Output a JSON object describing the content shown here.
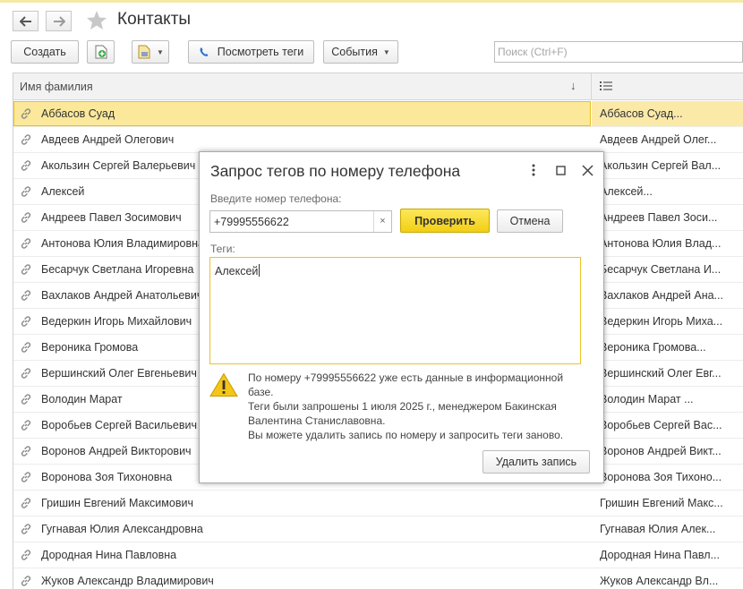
{
  "window": {
    "title": "Контакты",
    "nav": {
      "back_icon": "arrow-left-icon",
      "forward_icon": "arrow-right-icon",
      "favorite_icon": "star-icon"
    }
  },
  "toolbar": {
    "create_label": "Создать",
    "view_tags_label": "Посмотреть теги",
    "events_label": "События",
    "search_placeholder": "Поиск (Ctrl+F)"
  },
  "table": {
    "column_name": "Имя фамилия",
    "rows": [
      {
        "name": "Аббасов Суад",
        "tags": "Аббасов Суад..."
      },
      {
        "name": "Авдеев Андрей Олегович",
        "tags": "Авдеев Андрей Олег..."
      },
      {
        "name": "Акользин Сергей Валерьевич",
        "tags": "Акользин Сергей Вал..."
      },
      {
        "name": "Алексей",
        "tags": "Алексей..."
      },
      {
        "name": "Андреев Павел Зосимович",
        "tags": "Андреев Павел Зоси..."
      },
      {
        "name": "Антонова Юлия Владимировна",
        "tags": "Антонова Юлия Влад..."
      },
      {
        "name": "Бесарчук Светлана Игоревна",
        "tags": "Бесарчук Светлана И..."
      },
      {
        "name": "Вахлаков Андрей Анатольевич",
        "tags": "Вахлаков Андрей Ана..."
      },
      {
        "name": "Ведеркин Игорь Михайлович",
        "tags": "Ведеркин Игорь Миха..."
      },
      {
        "name": "Вероника Громова",
        "tags": "Вероника Громова..."
      },
      {
        "name": "Вершинский Олег Евгеньевич",
        "tags": "Вершинский Олег Евг..."
      },
      {
        "name": "Володин Марат",
        "tags": "Володин Марат ..."
      },
      {
        "name": "Воробьев Сергей Васильевич",
        "tags": "Воробьев Сергей Вас..."
      },
      {
        "name": "Воронов Андрей Викторович",
        "tags": "Воронов Андрей Викт..."
      },
      {
        "name": "Воронова Зоя Тихоновна",
        "tags": "Воронова Зоя Тихоно..."
      },
      {
        "name": "Гришин Евгений Максимович",
        "tags": "Гришин Евгений Макс..."
      },
      {
        "name": "Гугнавая Юлия Александровна",
        "tags": "Гугнавая Юлия Алек..."
      },
      {
        "name": "Дородная Нина Павловна",
        "tags": "Дородная Нина Павл..."
      },
      {
        "name": "Жуков Александр Владимирович",
        "tags": "Жуков Александр Вл..."
      }
    ]
  },
  "dialog": {
    "title": "Запрос тегов по номеру телефона",
    "phone_label": "Введите номер телефона:",
    "phone_value": "+79995556622",
    "clear_glyph": "×",
    "check_label": "Проверить",
    "cancel_label": "Отмена",
    "tags_label": "Теги:",
    "tags_value": "Алексей",
    "warning_lines": [
      "По номеру +79995556622 уже есть данные в информационной",
      "базе.",
      "Теги были запрошены 1 июля 2025 г., менеджером Бакинская",
      "Валентина Станиславовна.",
      "Вы можете удалить запись по номеру и запросить теги заново."
    ],
    "delete_label": "Удалить запись"
  },
  "colors": {
    "accent_yellow": "#f2cf14",
    "selected_row": "#fbe89a",
    "focus_border": "#eec225"
  }
}
